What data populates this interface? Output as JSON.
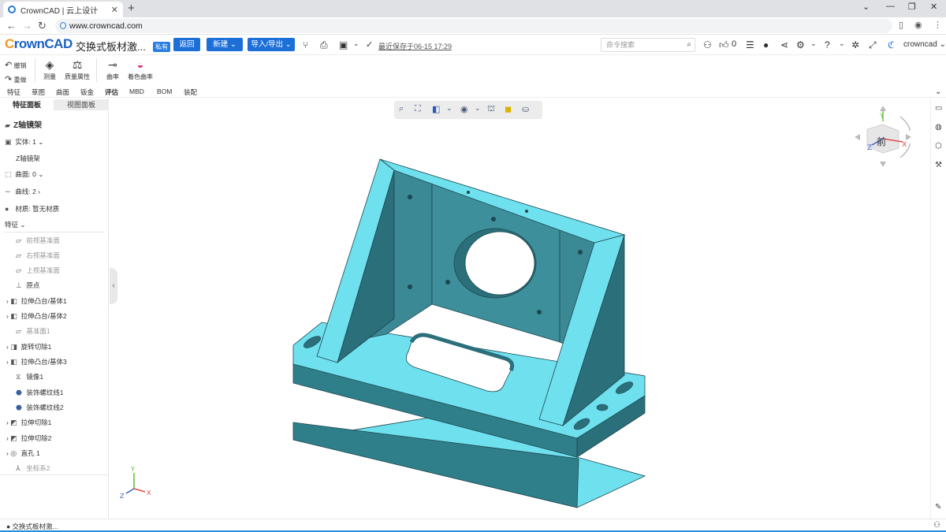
{
  "browser": {
    "tab_title": "CrownCAD | 云上设计",
    "url": "www.crowncad.com"
  },
  "app": {
    "logo_a": "C",
    "logo_b": "rownCAD",
    "doc_name": "交换式板材激...",
    "private_badge": "私有",
    "back_label": "返回",
    "new_label": "新建",
    "import_export_label": "导入/导出",
    "saved_text": "最近保存于06-15 17:29",
    "command_search_placeholder": "命令搜索",
    "like_count": "0",
    "user_name": "crowncad"
  },
  "ribbon": {
    "undo_label": "撤销",
    "redo_label": "重做",
    "buttons": [
      {
        "label": "测量"
      },
      {
        "label": "质量属性"
      },
      {
        "label": "曲率"
      },
      {
        "label": "着色曲率"
      }
    ]
  },
  "menu_tabs": [
    "特征",
    "草图",
    "曲面",
    "钣金",
    "评估",
    "MBD",
    "BOM",
    "装配"
  ],
  "left_panel": {
    "tab_feature": "特征面板",
    "tab_view": "视图面板",
    "part_name": "Z轴镜架",
    "solid_label": "实体: 1",
    "solid_item": "Z轴镜架",
    "surface_label": "曲面: 0",
    "curve_label": "曲线: 2",
    "material_label": "材质: 暂无材质",
    "feature_header": "特征",
    "features": [
      {
        "label": "前视基准面",
        "dim": true
      },
      {
        "label": "右视基准面",
        "dim": true
      },
      {
        "label": "上视基准面",
        "dim": true
      },
      {
        "label": "原点",
        "dim": false
      },
      {
        "label": "拉伸凸台/基体1",
        "dim": false
      },
      {
        "label": "拉伸凸台/基体2",
        "dim": false
      },
      {
        "label": "基准面1",
        "dim": true
      },
      {
        "label": "旋转切除1",
        "dim": false
      },
      {
        "label": "拉伸凸台/基体3",
        "dim": false
      },
      {
        "label": "镜像1",
        "dim": false
      },
      {
        "label": "装饰螺纹线1",
        "dim": false
      },
      {
        "label": "装饰螺纹线2",
        "dim": false
      },
      {
        "label": "拉伸切除1",
        "dim": false
      },
      {
        "label": "拉伸切除2",
        "dim": false
      },
      {
        "label": "直孔 1",
        "dim": false
      },
      {
        "label": "坐标系2",
        "dim": true
      }
    ]
  },
  "viewcube": {
    "face_label": "前",
    "axis_x": "X",
    "axis_y": "Y",
    "axis_z": "Z"
  },
  "triad": {
    "x": "X",
    "y": "Y",
    "z": "Z"
  },
  "status": {
    "text": "交换式板材激..."
  },
  "colors": {
    "model_face_light": "#6fe0ee",
    "model_face_dark": "#2a6f7a",
    "brand_blue": "#1d6fd8",
    "logo_orange": "#f39a1e"
  }
}
